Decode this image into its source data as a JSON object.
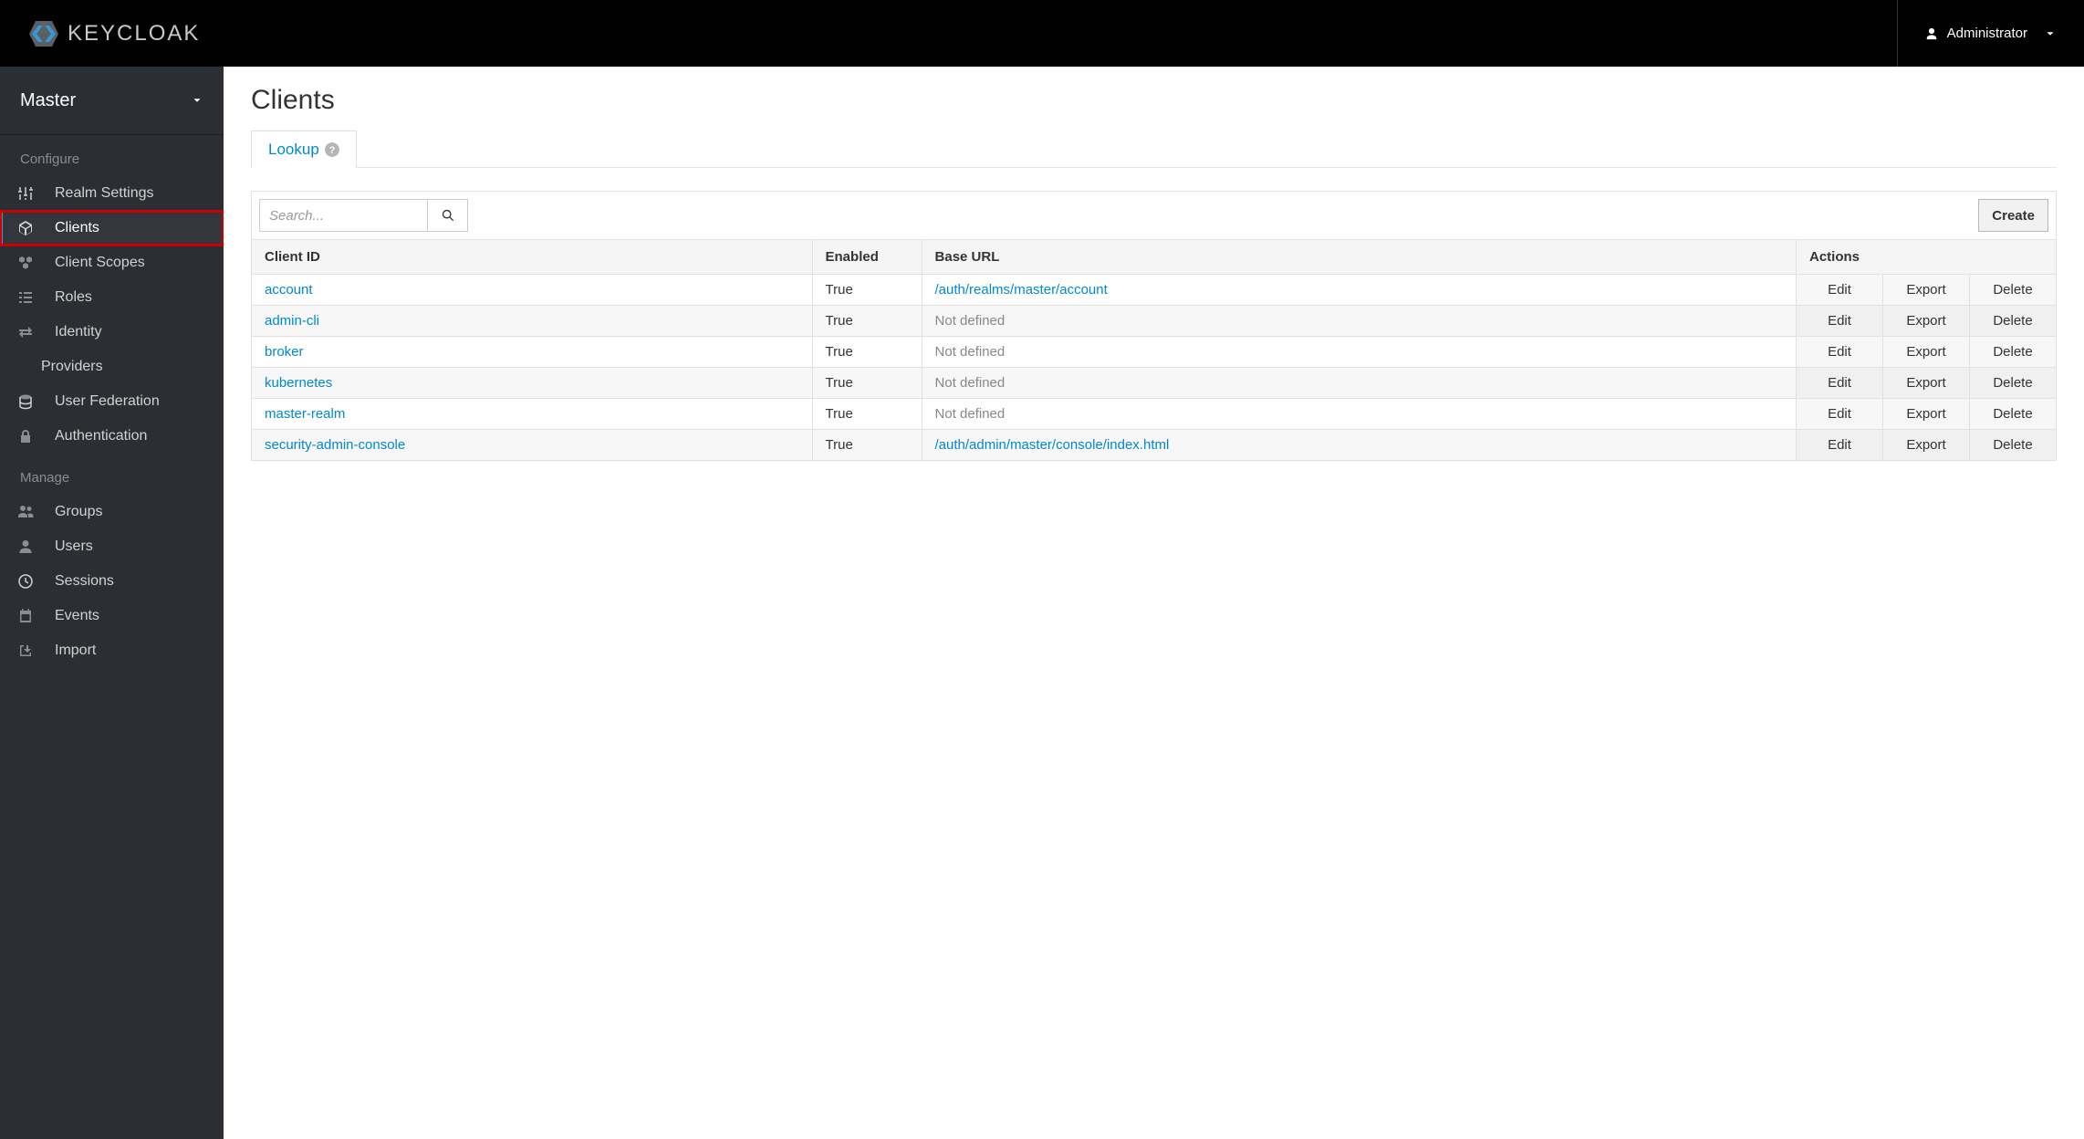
{
  "header": {
    "brand": "KEYCLOAK",
    "user": "Administrator"
  },
  "sidebar": {
    "realm": "Master",
    "sections": [
      {
        "label": "Configure",
        "items": [
          {
            "name": "realm-settings",
            "label": "Realm Settings",
            "icon": "sliders"
          },
          {
            "name": "clients",
            "label": "Clients",
            "icon": "cube",
            "active": true,
            "highlight": true
          },
          {
            "name": "client-scopes",
            "label": "Client Scopes",
            "icon": "cubes"
          },
          {
            "name": "roles",
            "label": "Roles",
            "icon": "list"
          },
          {
            "name": "identity",
            "label": "Identity",
            "icon": "exchange",
            "sublabel": "Providers"
          },
          {
            "name": "user-federation",
            "label": "User Federation",
            "icon": "database"
          },
          {
            "name": "authentication",
            "label": "Authentication",
            "icon": "lock"
          }
        ]
      },
      {
        "label": "Manage",
        "items": [
          {
            "name": "groups",
            "label": "Groups",
            "icon": "users"
          },
          {
            "name": "users",
            "label": "Users",
            "icon": "user"
          },
          {
            "name": "sessions",
            "label": "Sessions",
            "icon": "clock"
          },
          {
            "name": "events",
            "label": "Events",
            "icon": "calendar"
          },
          {
            "name": "import",
            "label": "Import",
            "icon": "import"
          }
        ]
      }
    ]
  },
  "page": {
    "title": "Clients",
    "tab": "Lookup",
    "searchPlaceholder": "Search...",
    "createLabel": "Create",
    "columns": {
      "clientId": "Client ID",
      "enabled": "Enabled",
      "baseUrl": "Base URL",
      "actions": "Actions"
    },
    "actions": {
      "edit": "Edit",
      "export": "Export",
      "delete": "Delete"
    },
    "rows": [
      {
        "id": "account",
        "enabled": "True",
        "baseUrl": "/auth/realms/master/account",
        "baseUrlLink": true
      },
      {
        "id": "admin-cli",
        "enabled": "True",
        "baseUrl": "Not defined",
        "baseUrlLink": false
      },
      {
        "id": "broker",
        "enabled": "True",
        "baseUrl": "Not defined",
        "baseUrlLink": false
      },
      {
        "id": "kubernetes",
        "enabled": "True",
        "baseUrl": "Not defined",
        "baseUrlLink": false
      },
      {
        "id": "master-realm",
        "enabled": "True",
        "baseUrl": "Not defined",
        "baseUrlLink": false
      },
      {
        "id": "security-admin-console",
        "enabled": "True",
        "baseUrl": "/auth/admin/master/console/index.html",
        "baseUrlLink": true
      }
    ]
  }
}
